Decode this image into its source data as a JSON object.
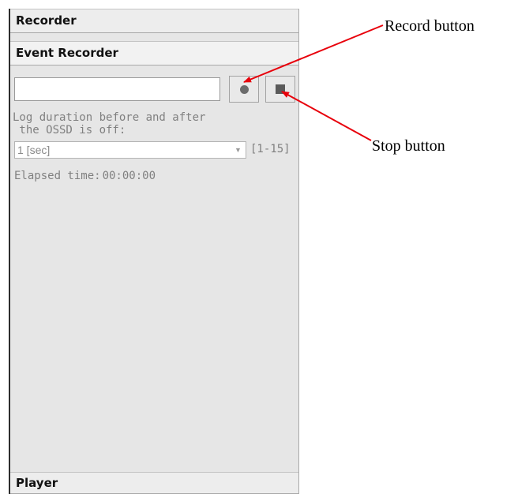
{
  "panel": {
    "recorder_header": "Recorder",
    "event_recorder_header": "Event Recorder",
    "filename_input": {
      "value": "",
      "placeholder": ""
    },
    "record_button": {
      "icon": "record-dot-icon"
    },
    "stop_button": {
      "icon": "stop-square-icon"
    },
    "log_duration_label": "Log duration before and after\n the OSSD is off:",
    "duration_select": {
      "value": "1 [sec]",
      "icon": "dropdown-arrow-icon"
    },
    "range_label": "[1-15]",
    "elapsed_label": "Elapsed time:",
    "elapsed_value": "00:00:00",
    "player_header": "Player"
  },
  "annotations": {
    "record_callout": "Record button",
    "stop_callout": "Stop button",
    "arrow_color": "#e8000b"
  },
  "colors": {
    "panel_background": "#e6e6e6",
    "header_background": "#ededed",
    "label_text": "#808080"
  }
}
